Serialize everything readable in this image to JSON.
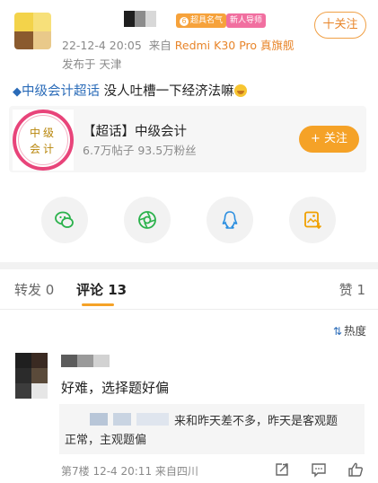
{
  "post": {
    "author": {
      "badge_famous": "超具名气",
      "badge_new": "新人导师",
      "follow_label": "十关注"
    },
    "meta": {
      "time": "22-12-4 20:05",
      "source_prefix": "来自",
      "device": "Redmi K30 Pro 真旗舰",
      "publish_location": "发布于 天津"
    },
    "text": {
      "topic": "中级会计超话",
      "body": " 没人吐槽一下经济法嘛"
    },
    "card": {
      "logo_line1": "中级",
      "logo_line2": "会计",
      "title": "【超话】中级会计",
      "stats": "6.7万帖子 93.5万粉丝",
      "follow_label": "+ 关注"
    },
    "share": [
      {
        "name": "wechat-icon"
      },
      {
        "name": "moments-icon"
      },
      {
        "name": "qq-icon"
      },
      {
        "name": "save-image-icon"
      }
    ]
  },
  "tabs": {
    "repost": "转发 0",
    "comment": "评论 13",
    "like": "赞 1"
  },
  "sort_label": "热度",
  "comment": {
    "text": "好难，选择题好偏",
    "reply_line1": "来和昨天差不多，昨天是客观题",
    "reply_line2": "正常，主观题偏",
    "meta": "第7楼 12-4 20:11 来自四川"
  },
  "colors": {
    "accent_orange": "#f5a227",
    "link_blue": "#2a6bb8",
    "badge_pink": "#f16fa0"
  }
}
